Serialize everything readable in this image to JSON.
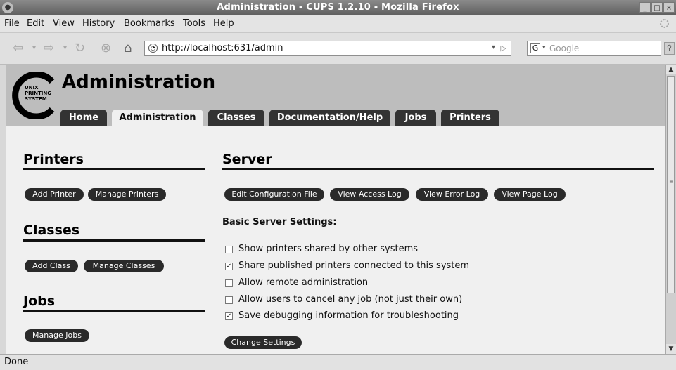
{
  "window": {
    "title": "Administration - CUPS 1.2.10 - Mozilla Firefox"
  },
  "menu": [
    "File",
    "Edit",
    "View",
    "History",
    "Bookmarks",
    "Tools",
    "Help"
  ],
  "nav": {
    "url": "http://localhost:631/admin",
    "search_placeholder": "Google"
  },
  "page": {
    "title": "Administration",
    "logo_text": [
      "UNIX",
      "PRINTING",
      "SYSTEM"
    ],
    "tabs": [
      {
        "label": "Home",
        "active": false
      },
      {
        "label": "Administration",
        "active": true
      },
      {
        "label": "Classes",
        "active": false
      },
      {
        "label": "Documentation/Help",
        "active": false
      },
      {
        "label": "Jobs",
        "active": false
      },
      {
        "label": "Printers",
        "active": false
      }
    ],
    "printers": {
      "heading": "Printers",
      "buttons": [
        "Add Printer",
        "Manage Printers"
      ]
    },
    "classes": {
      "heading": "Classes",
      "buttons": [
        "Add Class",
        "Manage Classes"
      ]
    },
    "jobs": {
      "heading": "Jobs",
      "buttons": [
        "Manage Jobs"
      ]
    },
    "server": {
      "heading": "Server",
      "buttons": [
        "Edit Configuration File",
        "View Access Log",
        "View Error Log",
        "View Page Log"
      ],
      "settings_heading": "Basic Server Settings:",
      "settings": [
        {
          "label": "Show printers shared by other systems",
          "checked": false
        },
        {
          "label": "Share published printers connected to this system",
          "checked": true
        },
        {
          "label": "Allow remote administration",
          "checked": false
        },
        {
          "label": "Allow users to cancel any job (not just their own)",
          "checked": false
        },
        {
          "label": "Save debugging information for troubleshooting",
          "checked": true
        }
      ],
      "submit": "Change Settings"
    }
  },
  "status": "Done"
}
